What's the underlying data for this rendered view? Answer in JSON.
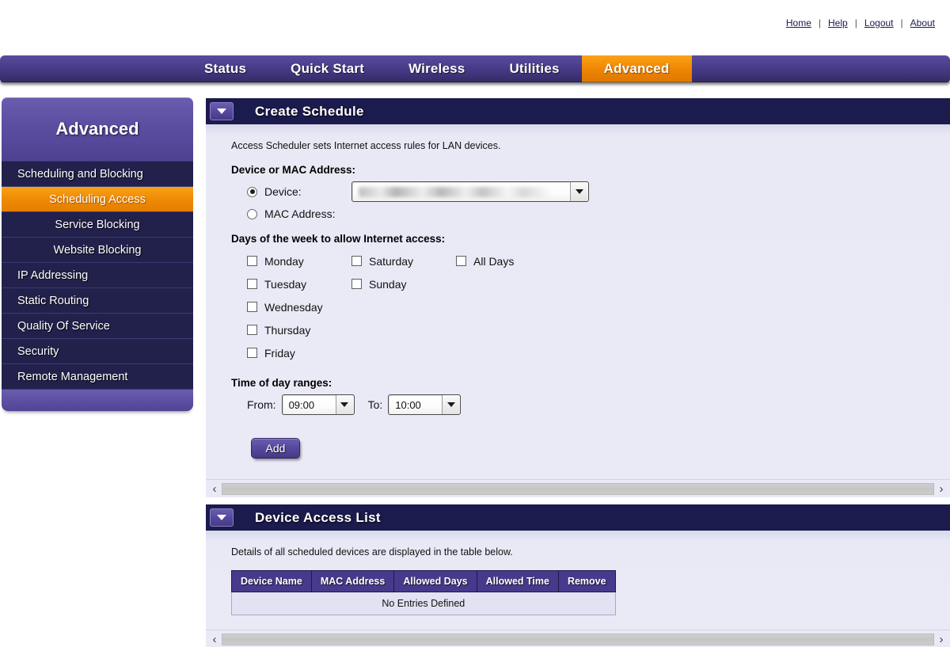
{
  "toplinks": [
    {
      "label": "Home"
    },
    {
      "label": "Help"
    },
    {
      "label": "Logout"
    },
    {
      "label": "About"
    }
  ],
  "separator": "|",
  "nav": {
    "items": [
      {
        "label": "Status",
        "active": false
      },
      {
        "label": "Quick Start",
        "active": false
      },
      {
        "label": "Wireless",
        "active": false
      },
      {
        "label": "Utilities",
        "active": false
      },
      {
        "label": "Advanced",
        "active": true
      }
    ]
  },
  "sidebar": {
    "title": "Advanced",
    "items": [
      {
        "label": "Scheduling and Blocking",
        "sub": false,
        "active": false
      },
      {
        "label": "Scheduling Access",
        "sub": true,
        "active": true
      },
      {
        "label": "Service Blocking",
        "sub": true,
        "active": false
      },
      {
        "label": "Website Blocking",
        "sub": true,
        "active": false
      },
      {
        "label": "IP Addressing",
        "sub": false,
        "active": false
      },
      {
        "label": "Static Routing",
        "sub": false,
        "active": false
      },
      {
        "label": "Quality Of Service",
        "sub": false,
        "active": false
      },
      {
        "label": "Security",
        "sub": false,
        "active": false
      },
      {
        "label": "Remote Management",
        "sub": false,
        "active": false
      }
    ]
  },
  "create_schedule": {
    "title": "Create Schedule",
    "description": "Access Scheduler sets Internet access rules for LAN devices.",
    "device_section_label": "Device or MAC Address:",
    "device_radio_label": "Device:",
    "device_radio_selected": true,
    "device_select_value": "",
    "mac_radio_label": "MAC Address:",
    "mac_radio_selected": false,
    "days_label": "Days of the week to allow Internet access:",
    "days_col1": [
      {
        "label": "Monday",
        "checked": false
      },
      {
        "label": "Tuesday",
        "checked": false
      },
      {
        "label": "Wednesday",
        "checked": false
      },
      {
        "label": "Thursday",
        "checked": false
      },
      {
        "label": "Friday",
        "checked": false
      }
    ],
    "days_col2": [
      {
        "label": "Saturday",
        "checked": false
      },
      {
        "label": "Sunday",
        "checked": false
      }
    ],
    "days_col3": [
      {
        "label": "All Days",
        "checked": false
      }
    ],
    "time_label": "Time of day ranges:",
    "from_label": "From:",
    "from_value": "09:00",
    "to_label": "To:",
    "to_value": "10:00",
    "add_button": "Add"
  },
  "device_access_list": {
    "title": "Device Access List",
    "description": "Details of all scheduled devices are displayed in the table below.",
    "columns": [
      "Device Name",
      "MAC Address",
      "Allowed Days",
      "Allowed Time",
      "Remove"
    ],
    "empty_message": "No Entries Defined"
  },
  "scrollbar": {
    "left_arrow": "‹",
    "right_arrow": "›"
  },
  "colors": {
    "nav_purple": "#473a8c",
    "accent_orange": "#ef8a04",
    "panel_header": "#1b1b4d",
    "panel_body": "#e9e9f6",
    "sidebar_item": "#21214c"
  }
}
